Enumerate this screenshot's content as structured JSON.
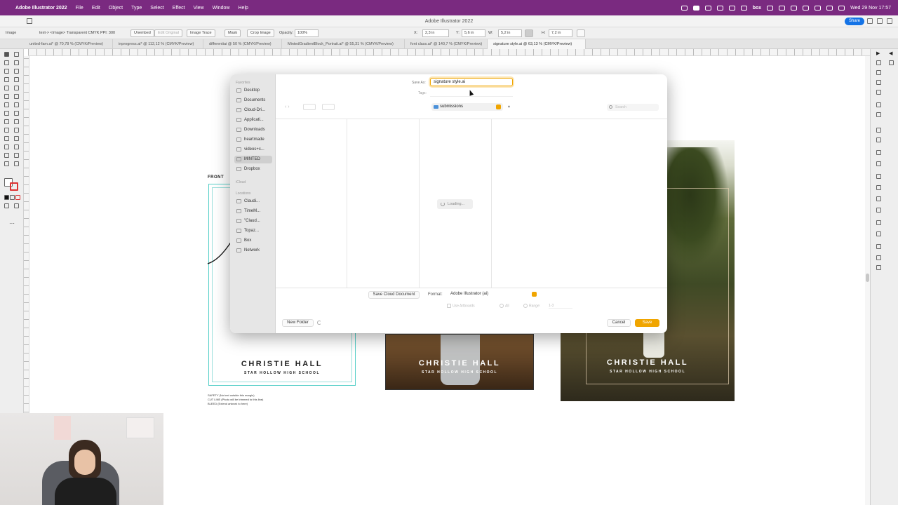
{
  "menubar": {
    "app": "Adobe Illustrator 2022",
    "items": [
      "File",
      "Edit",
      "Object",
      "Type",
      "Select",
      "Effect",
      "View",
      "Window",
      "Help"
    ],
    "clock": "Wed 29 Nov 17:57",
    "box_label": "box"
  },
  "window": {
    "title": "Adobe Illustrator 2022",
    "share_label": "Share"
  },
  "control_bar": {
    "selection": "Image",
    "link_info": "text-> <Image>  Transparent CMYK  PPI: 300",
    "embed": "Unembed",
    "edit_original": "Edit Original",
    "image_trace": "Image Trace",
    "mask": "Mask",
    "crop": "Crop Image",
    "opacity_label": "Opacity:",
    "opacity_value": "100%",
    "x_label": "X:",
    "x_value": "2,3 in",
    "y_label": "Y:",
    "y_value": "5,6 in",
    "w_label": "W:",
    "w_value": "5,2 in",
    "h_label": "H:",
    "h_value": "7,2 in"
  },
  "tabs": [
    {
      "label": "united-fam.ai* @ 70,78 % (CMYK/Preview)",
      "active": false
    },
    {
      "label": "inprogress.ai* @ 112,12 % (CMYK/Preview)",
      "active": false
    },
    {
      "label": "differentiai @ 50 % (CMYK/Preview)",
      "active": false
    },
    {
      "label": "MintedGradientBlock_Portrait.ai* @ 55,31 % (CMYK/Preview)",
      "active": false
    },
    {
      "label": "font class.ai* @ 140,7 % (CMYK/Preview)",
      "active": false
    },
    {
      "label": "signature style.ai @ 63,13 % (CMYK/Preview)",
      "active": true
    }
  ],
  "canvas": {
    "front_label": "FRONT",
    "cards": [
      {
        "name": "CHRISTIE HALL",
        "school": "STAR HOLLOW HIGH SCHOOL"
      },
      {
        "name": "CHRISTIE HALL",
        "school": "STAR HOLLOW HIGH SCHOOL"
      },
      {
        "name": "CHRISTIE HALL",
        "school": "STAR HOLLOW HIGH SCHOOL"
      }
    ],
    "notes": [
      "SAFETY (No text outside this margin)",
      "CUT LINE (Photo will be trimmed to this line)",
      "BLEED (Extend artwork to here)"
    ]
  },
  "dialog": {
    "save_as_label": "Save As:",
    "save_as_value": "signature style.ai",
    "tags_label": "Tags:",
    "location": "submissions",
    "search_placeholder": "Search",
    "loading": "Loading...",
    "sidebar": {
      "favorites_header": "Favorites",
      "favorites": [
        "Desktop",
        "Documents",
        "Cloud-Dri...",
        "Applicati...",
        "Downloads",
        "heartmade",
        "videos+c...",
        "MINTED",
        "Dropbox"
      ],
      "selected": "MINTED",
      "icloud_header": "iCloud",
      "locations_header": "Locations",
      "locations": [
        "Claudi...",
        "TimeM...",
        "\"Claud...",
        "Topaz...",
        "Box",
        "Network"
      ]
    },
    "save_cloud": "Save Cloud Document",
    "format_label": "Format:",
    "format_value": "Adobe Illustrator (ai)",
    "use_artboards": "Use Artboards",
    "all": "All",
    "range_label": "Range:",
    "range_value": "1-3",
    "new_folder": "New Folder",
    "cancel": "Cancel",
    "save": "Save"
  }
}
